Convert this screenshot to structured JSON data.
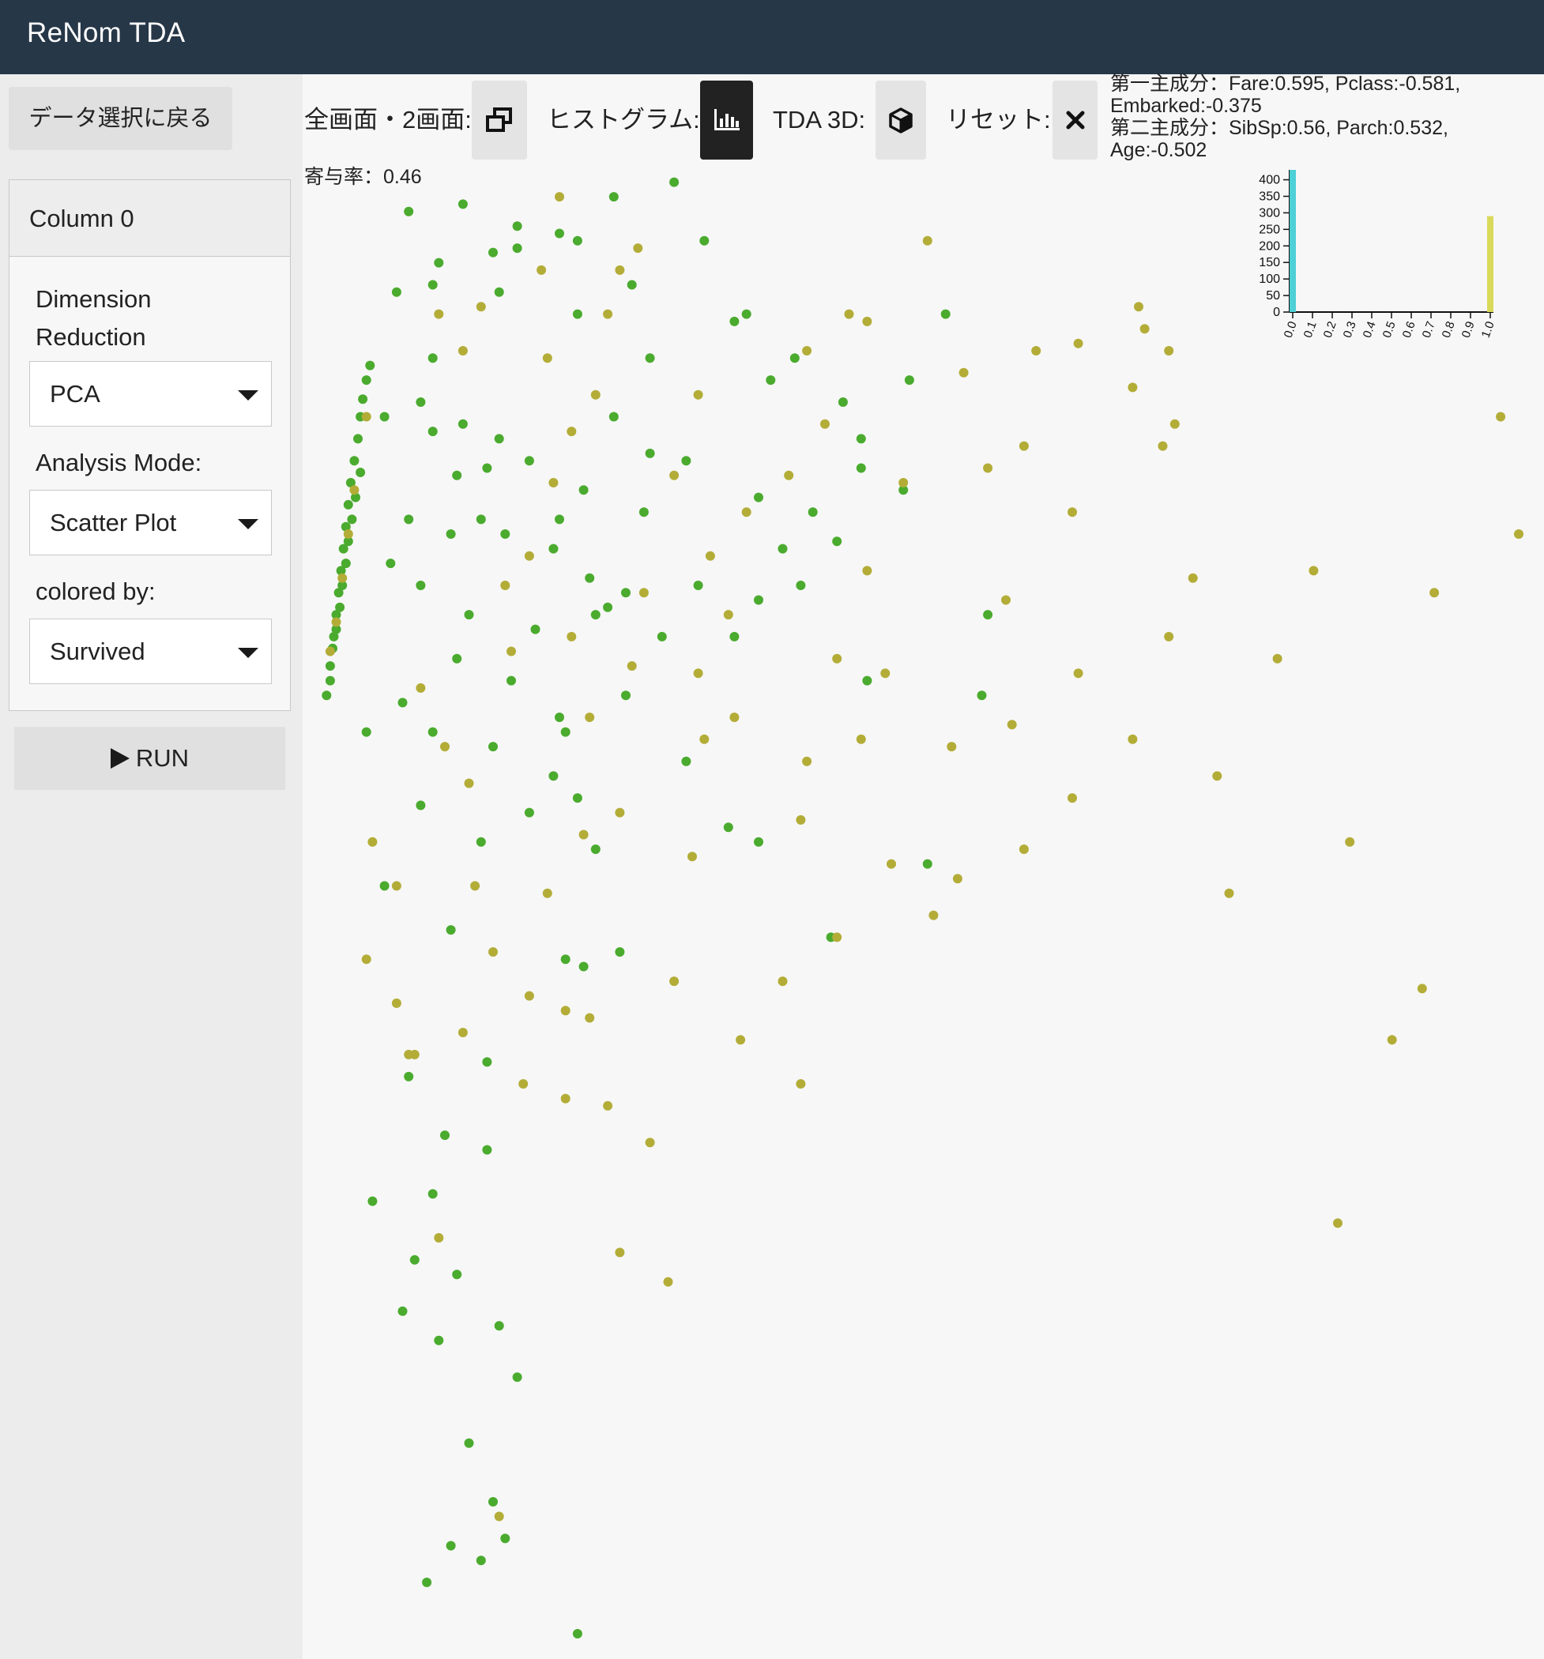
{
  "app": {
    "title": "ReNom TDA"
  },
  "sidebar": {
    "back_button": "データ選択に戻る",
    "panel_title": "Column 0",
    "dim_reduction_label": "Dimension Reduction",
    "dim_reduction_value": "PCA",
    "analysis_mode_label": "Analysis Mode:",
    "analysis_mode_value": "Scatter Plot",
    "colored_by_label": "colored by:",
    "colored_by_value": "Survived",
    "run_label": "RUN"
  },
  "toolbar": {
    "fullscreen_label": "全画面・2画面:",
    "histogram_label": "ヒストグラム:",
    "tda3d_label": "TDA 3D:",
    "reset_label": "リセット:"
  },
  "pca": {
    "pc1": "第一主成分：Fare:0.595, Pclass:-0.581, Embarked:-0.375",
    "pc2": "第二主成分：SibSp:0.56, Parch:0.532, Age:-0.502",
    "contribution": "寄与率：0.46"
  },
  "colors": {
    "header_bg": "#263748",
    "survived_0": "#4aab2e",
    "survived_1": "#b3ad38",
    "hist_low": "#4dd0d6",
    "hist_high": "#d9d95a"
  },
  "chart_data": [
    {
      "type": "bar",
      "title": "",
      "categories": [
        "0.0",
        "0.1",
        "0.2",
        "0.3",
        "0.4",
        "0.5",
        "0.6",
        "0.7",
        "0.8",
        "0.9",
        "1.0"
      ],
      "bars": [
        {
          "x": 0.0,
          "value": 430,
          "color": "#4dd0d6"
        },
        {
          "x": 1.0,
          "value": 290,
          "color": "#d9d95a"
        }
      ],
      "yticks": [
        0,
        50,
        100,
        150,
        200,
        250,
        300,
        350,
        400
      ],
      "ylim": [
        0,
        430
      ]
    },
    {
      "type": "scatter",
      "title": "",
      "xlabel": "",
      "ylabel": "",
      "xlim": [
        -2.0,
        8.0
      ],
      "ylim": [
        -7.7,
        2.3
      ],
      "series": [
        {
          "color": "#4aab2e",
          "points": [
            [
              -1.88,
              -1.3
            ],
            [
              -1.85,
              -1.1
            ],
            [
              -1.82,
              -0.9
            ],
            [
              -1.8,
              -0.75
            ],
            [
              -1.78,
              -0.6
            ],
            [
              -1.76,
              -0.45
            ],
            [
              -1.74,
              -0.3
            ],
            [
              -1.72,
              -0.15
            ],
            [
              -1.7,
              0.0
            ],
            [
              -1.68,
              0.15
            ],
            [
              -1.65,
              0.3
            ],
            [
              -1.62,
              0.45
            ],
            [
              -1.6,
              0.6
            ],
            [
              -1.58,
              0.72
            ],
            [
              -1.55,
              0.85
            ],
            [
              -1.52,
              0.95
            ],
            [
              -1.83,
              -0.98
            ],
            [
              -1.8,
              -0.85
            ],
            [
              -1.77,
              -0.7
            ],
            [
              -1.75,
              -0.55
            ],
            [
              -1.72,
              -0.4
            ],
            [
              -1.7,
              -0.25
            ],
            [
              -1.67,
              -0.1
            ],
            [
              -1.64,
              0.05
            ],
            [
              -1.6,
              0.22
            ],
            [
              -1.85,
              -1.2
            ],
            [
              -1.2,
              2.0
            ],
            [
              -0.75,
              2.05
            ],
            [
              -0.5,
              1.72
            ],
            [
              -0.95,
              1.65
            ],
            [
              -1.3,
              1.45
            ],
            [
              -1.0,
              1.0
            ],
            [
              -0.3,
              1.9
            ],
            [
              -0.3,
              1.75
            ],
            [
              0.05,
              1.85
            ],
            [
              -0.45,
              1.45
            ],
            [
              -1.0,
              1.5
            ],
            [
              -1.4,
              0.6
            ],
            [
              -1.1,
              0.7
            ],
            [
              -0.75,
              0.55
            ],
            [
              -0.55,
              0.25
            ],
            [
              -1.0,
              0.5
            ],
            [
              -0.8,
              0.2
            ],
            [
              -0.6,
              -0.1
            ],
            [
              -0.45,
              0.45
            ],
            [
              -0.85,
              -0.2
            ],
            [
              -1.2,
              -0.1
            ],
            [
              -1.35,
              -0.4
            ],
            [
              -1.1,
              -0.55
            ],
            [
              -0.7,
              -0.75
            ],
            [
              -0.4,
              -0.2
            ],
            [
              -0.2,
              0.3
            ],
            [
              0.0,
              -0.3
            ],
            [
              0.3,
              -0.5
            ],
            [
              0.25,
              0.1
            ],
            [
              0.05,
              -0.1
            ],
            [
              -0.15,
              -0.85
            ],
            [
              -0.35,
              -1.2
            ],
            [
              -0.8,
              -1.05
            ],
            [
              -1.25,
              -1.35
            ],
            [
              -1.55,
              -1.55
            ],
            [
              -1.0,
              -1.55
            ],
            [
              -0.5,
              -1.65
            ],
            [
              0.0,
              -1.85
            ],
            [
              -0.2,
              -2.1
            ],
            [
              0.1,
              -1.55
            ],
            [
              -1.1,
              -2.05
            ],
            [
              -0.6,
              -2.3
            ],
            [
              -1.4,
              -2.6
            ],
            [
              0.35,
              -2.35
            ],
            [
              -0.85,
              -2.9
            ],
            [
              0.25,
              -3.15
            ],
            [
              -1.2,
              -3.9
            ],
            [
              -0.55,
              -3.8
            ],
            [
              -0.9,
              -4.3
            ],
            [
              -0.55,
              -4.4
            ],
            [
              -1.5,
              -4.75
            ],
            [
              -1.0,
              -4.7
            ],
            [
              -1.15,
              -5.15
            ],
            [
              -0.8,
              -5.25
            ],
            [
              -1.25,
              -5.5
            ],
            [
              -0.45,
              -5.6
            ],
            [
              -0.95,
              -5.7
            ],
            [
              -0.3,
              -5.95
            ],
            [
              -0.7,
              -6.4
            ],
            [
              -0.5,
              -6.8
            ],
            [
              -0.6,
              -7.2
            ],
            [
              -0.4,
              -7.05
            ],
            [
              -0.85,
              -7.1
            ],
            [
              0.2,
              -7.7
            ],
            [
              -1.05,
              -7.35
            ],
            [
              0.45,
              -0.7
            ],
            [
              0.6,
              -1.3
            ],
            [
              0.9,
              -0.9
            ],
            [
              1.1,
              -1.75
            ],
            [
              1.5,
              -0.9
            ],
            [
              1.7,
              -0.65
            ],
            [
              2.3,
              -2.95
            ],
            [
              0.75,
              -0.05
            ],
            [
              0.35,
              -0.75
            ],
            [
              0.55,
              -3.05
            ],
            [
              0.1,
              -3.1
            ],
            [
              2.05,
              -0.55
            ],
            [
              2.6,
              -1.2
            ],
            [
              3.1,
              -2.45
            ],
            [
              3.55,
              -1.3
            ],
            [
              2.55,
              0.25
            ],
            [
              2.9,
              0.1
            ],
            [
              0.5,
              0.6
            ],
            [
              0.8,
              1.0
            ],
            [
              0.2,
              1.3
            ],
            [
              0.65,
              1.5
            ],
            [
              0.2,
              1.8
            ],
            [
              0.5,
              2.1
            ],
            [
              1.25,
              1.8
            ],
            [
              1.0,
              2.2
            ],
            [
              1.5,
              1.25
            ],
            [
              2.0,
              1.0
            ],
            [
              0.8,
              0.35
            ],
            [
              1.1,
              0.3
            ],
            [
              1.8,
              0.85
            ],
            [
              1.6,
              1.3
            ],
            [
              2.4,
              0.7
            ],
            [
              0.6,
              -0.6
            ],
            [
              1.2,
              -0.55
            ],
            [
              1.9,
              -0.3
            ],
            [
              2.15,
              -0.05
            ],
            [
              1.7,
              0.05
            ],
            [
              2.55,
              0.45
            ],
            [
              2.35,
              -0.25
            ],
            [
              3.25,
              1.3
            ],
            [
              2.95,
              0.85
            ],
            [
              3.6,
              -0.75
            ],
            [
              1.45,
              -2.2
            ],
            [
              1.7,
              -2.3
            ],
            [
              0.2,
              -2.0
            ],
            [
              0.05,
              -1.45
            ]
          ]
        },
        {
          "color": "#b3ad38",
          "points": [
            [
              -1.85,
              -1.0
            ],
            [
              -1.8,
              -0.8
            ],
            [
              -1.75,
              -0.5
            ],
            [
              -1.7,
              -0.2
            ],
            [
              -1.65,
              0.1
            ],
            [
              -1.55,
              0.6
            ],
            [
              -1.5,
              -2.3
            ],
            [
              -1.55,
              -3.1
            ],
            [
              -1.3,
              -2.6
            ],
            [
              -1.1,
              -1.25
            ],
            [
              -0.9,
              -1.65
            ],
            [
              -0.7,
              -1.9
            ],
            [
              -0.65,
              -2.6
            ],
            [
              -0.35,
              -1.0
            ],
            [
              -0.4,
              -0.55
            ],
            [
              -0.2,
              -0.35
            ],
            [
              0.0,
              0.15
            ],
            [
              0.15,
              0.5
            ],
            [
              -0.05,
              1.0
            ],
            [
              -0.6,
              1.35
            ],
            [
              -0.75,
              1.05
            ],
            [
              -0.95,
              1.3
            ],
            [
              0.35,
              0.75
            ],
            [
              0.45,
              1.3
            ],
            [
              0.55,
              1.6
            ],
            [
              0.7,
              1.75
            ],
            [
              0.05,
              2.1
            ],
            [
              -0.1,
              1.6
            ],
            [
              1.2,
              0.75
            ],
            [
              1.0,
              0.2
            ],
            [
              1.3,
              -0.35
            ],
            [
              1.45,
              -0.75
            ],
            [
              1.5,
              -1.45
            ],
            [
              1.25,
              -1.6
            ],
            [
              0.65,
              -1.1
            ],
            [
              0.3,
              -1.45
            ],
            [
              0.15,
              -0.9
            ],
            [
              0.55,
              -2.1
            ],
            [
              0.25,
              -2.25
            ],
            [
              -0.05,
              -2.65
            ],
            [
              -0.5,
              -3.05
            ],
            [
              -0.2,
              -3.35
            ],
            [
              0.1,
              -3.45
            ],
            [
              0.3,
              -3.5
            ],
            [
              -1.3,
              -3.4
            ],
            [
              -1.15,
              -3.75
            ],
            [
              -0.25,
              -3.95
            ],
            [
              0.45,
              -4.1
            ],
            [
              0.1,
              -4.05
            ],
            [
              0.8,
              -4.35
            ],
            [
              0.55,
              -5.1
            ],
            [
              0.95,
              -5.3
            ],
            [
              1.0,
              -3.25
            ],
            [
              1.15,
              -2.4
            ],
            [
              1.55,
              -3.65
            ],
            [
              1.9,
              -3.25
            ],
            [
              2.05,
              -3.95
            ],
            [
              2.35,
              -2.95
            ],
            [
              2.05,
              -2.15
            ],
            [
              2.1,
              -1.75
            ],
            [
              2.75,
              -1.15
            ],
            [
              2.55,
              -1.6
            ],
            [
              2.8,
              -2.45
            ],
            [
              2.35,
              -1.05
            ],
            [
              2.6,
              -0.45
            ],
            [
              2.25,
              0.55
            ],
            [
              2.45,
              1.3
            ],
            [
              2.6,
              1.25
            ],
            [
              1.95,
              0.2
            ],
            [
              3.1,
              1.8
            ],
            [
              2.9,
              0.15
            ],
            [
              3.4,
              0.9
            ],
            [
              3.6,
              0.25
            ],
            [
              3.9,
              0.4
            ],
            [
              4.0,
              1.05
            ],
            [
              3.75,
              -0.65
            ],
            [
              4.35,
              1.1
            ],
            [
              4.3,
              -0.05
            ],
            [
              4.35,
              -1.15
            ],
            [
              3.9,
              -2.35
            ],
            [
              4.9,
              1.2
            ],
            [
              4.8,
              0.8
            ],
            [
              3.8,
              -1.5
            ],
            [
              3.3,
              -1.65
            ],
            [
              5.05,
              0.4
            ],
            [
              5.3,
              -0.5
            ],
            [
              5.1,
              -0.9
            ],
            [
              6.3,
              -0.45
            ],
            [
              6.0,
              -1.05
            ],
            [
              5.6,
              -2.65
            ],
            [
              6.5,
              -4.9
            ],
            [
              7.2,
              -3.3
            ],
            [
              6.95,
              -3.65
            ],
            [
              7.3,
              -0.6
            ],
            [
              8.0,
              -0.2
            ],
            [
              7.85,
              0.6
            ],
            [
              6.6,
              -2.3
            ],
            [
              5.5,
              -1.85
            ],
            [
              4.8,
              -1.6
            ],
            [
              4.3,
              -2.0
            ],
            [
              3.15,
              -2.8
            ],
            [
              3.35,
              -2.55
            ],
            [
              5.15,
              0.55
            ],
            [
              5.1,
              1.05
            ],
            [
              4.85,
              1.35
            ],
            [
              2.1,
              1.05
            ],
            [
              1.6,
              -0.05
            ],
            [
              1.2,
              -1.15
            ],
            [
              0.75,
              -0.6
            ],
            [
              -1.2,
              -3.75
            ],
            [
              -0.75,
              -3.6
            ],
            [
              -0.95,
              -5.0
            ],
            [
              -0.45,
              -6.9
            ]
          ]
        }
      ]
    }
  ]
}
